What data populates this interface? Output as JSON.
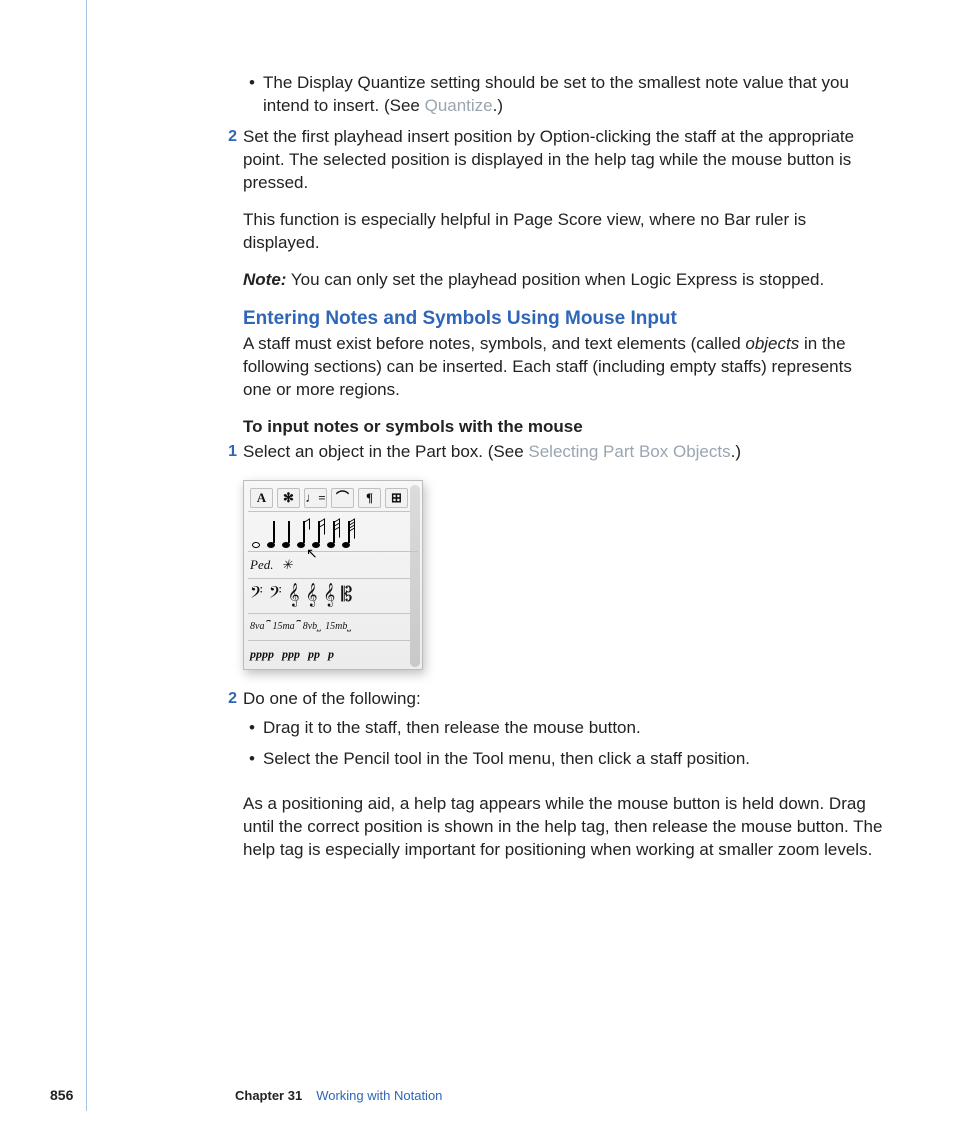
{
  "bullet1": {
    "pre": "The Display Quantize setting should be set to the smallest note value that you intend to insert. (See ",
    "link": "Quantize",
    "post": ".)"
  },
  "step2_num": "2",
  "step2_para1": "Set the first playhead insert position by Option-clicking the staff at the appropriate point. The selected position is displayed in the help tag while the mouse button is pressed.",
  "step2_para2": "This function is especially helpful in Page Score view, where no Bar ruler is displayed.",
  "note_label": "Note:",
  "note_text": "  You can only set the playhead position when Logic Express is stopped.",
  "heading": "Entering Notes and Symbols Using Mouse Input",
  "intro_pre": "A staff must exist before notes, symbols, and text elements (called ",
  "intro_ital": "objects",
  "intro_post": " in the following sections) can be inserted. Each staff (including empty staffs) represents one or more regions.",
  "procedure_title": "To input notes or symbols with the mouse",
  "proc1_num": "1",
  "proc1_pre": "Select an object in the Part box. (See ",
  "proc1_link": "Selecting Part Box Objects",
  "proc1_post": ".)",
  "partbox": {
    "tab_A": "A",
    "tab_seg": "✻",
    "tab_note": "♩=",
    "tab_bow": "⌒",
    "tab_para": "¶",
    "tab_grid": "⊞",
    "ped": "Ped.",
    "ped_rel": "✳",
    "clef1": "𝄢",
    "clef2": "𝄢",
    "clef3": "𝄞",
    "clef4": "𝄞",
    "clef5": "𝄞",
    "clef6": "𝄡",
    "oct1": "8va⎴",
    "oct2": "15ma⎴",
    "oct3": "8vb⎵",
    "oct4": "15mb⎵",
    "dyn1": "pppp",
    "dyn2": "ppp",
    "dyn3": "pp",
    "dyn4": "p"
  },
  "proc2_num": "2",
  "proc2_text": "Do one of the following:",
  "proc2_b1": "Drag it to the staff, then release the mouse button.",
  "proc2_b2": "Select the Pencil tool in the Tool menu, then click a staff position.",
  "proc2_para": "As a positioning aid, a help tag appears while the mouse button is held down. Drag until the correct position is shown in the help tag, then release the mouse button. The help tag is especially important for positioning when working at smaller zoom levels.",
  "footer": {
    "page_num": "856",
    "chapter_label": "Chapter 31",
    "chapter_title": "Working with Notation"
  }
}
